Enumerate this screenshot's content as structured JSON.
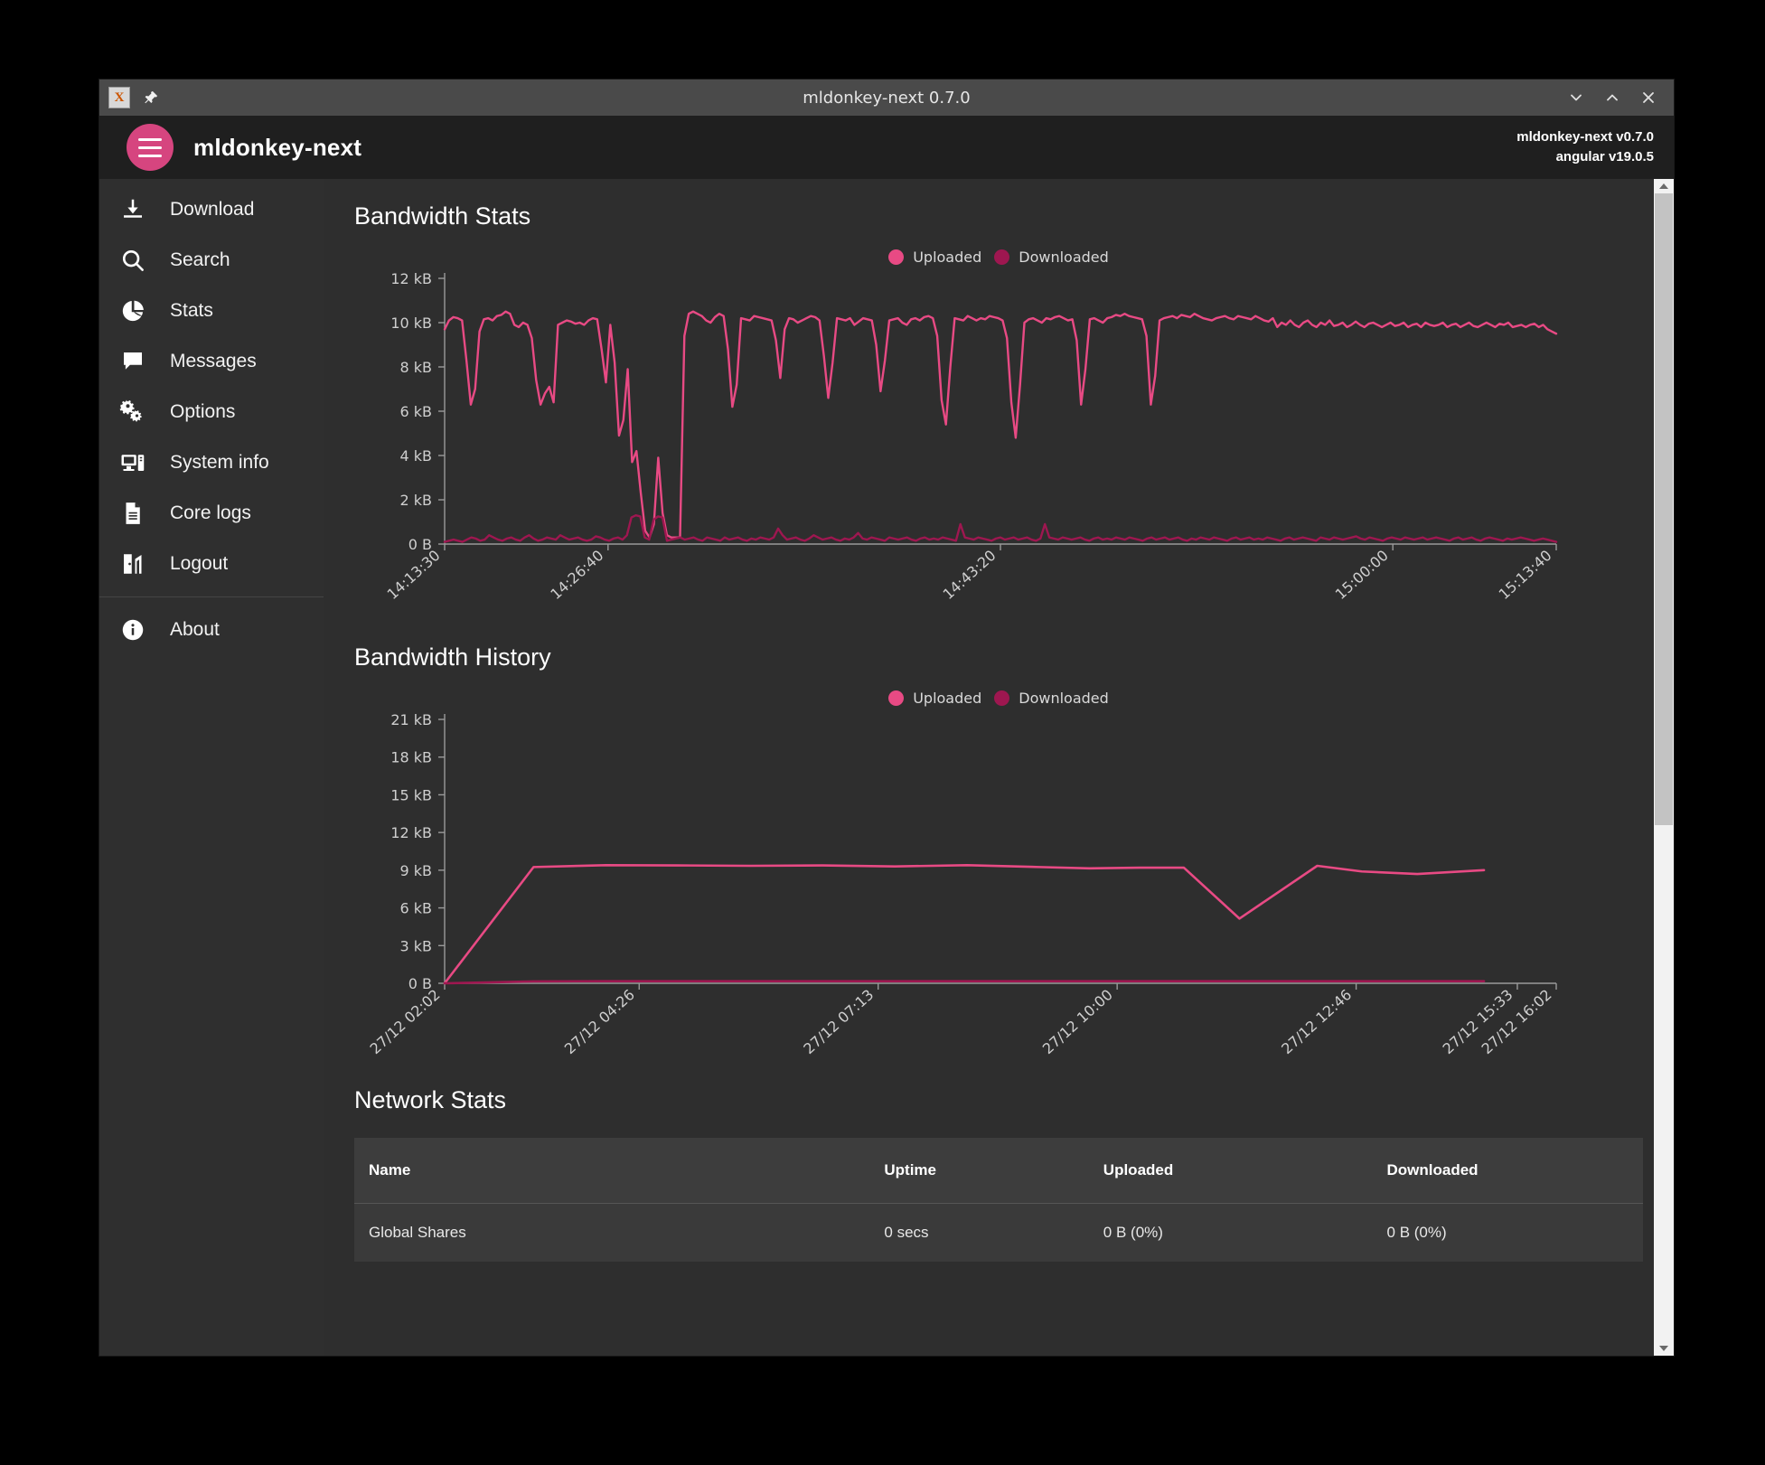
{
  "window": {
    "title": "mldonkey-next 0.7.0",
    "app_icon": "x-app-icon",
    "pin_icon": "pin-icon",
    "minimize_icon": "chevron-down-icon",
    "maximize_icon": "chevron-up-icon",
    "close_icon": "close-icon"
  },
  "appbar": {
    "menu_icon": "hamburger-menu-icon",
    "title": "mldonkey-next",
    "version_app": "mldonkey-next v0.7.0",
    "version_framework": "angular v19.0.5"
  },
  "sidebar": {
    "items": [
      {
        "label": "Download",
        "icon": "download-icon"
      },
      {
        "label": "Search",
        "icon": "search-icon"
      },
      {
        "label": "Stats",
        "icon": "pie-chart-icon"
      },
      {
        "label": "Messages",
        "icon": "chat-bubble-icon"
      },
      {
        "label": "Options",
        "icon": "gears-icon"
      },
      {
        "label": "System info",
        "icon": "desktop-tower-icon"
      },
      {
        "label": "Core logs",
        "icon": "document-icon"
      },
      {
        "label": "Logout",
        "icon": "logout-door-icon"
      }
    ],
    "footer": [
      {
        "label": "About",
        "icon": "info-icon"
      }
    ]
  },
  "colors": {
    "uploaded": "#e84a84",
    "downloaded": "#9e1750",
    "axis": "#9a9a9a",
    "background": "#2e2e2e",
    "accent": "#d6457f"
  },
  "main": {
    "bandwidth_stats_title": "Bandwidth Stats",
    "bandwidth_history_title": "Bandwidth History",
    "network_stats_title": "Network Stats",
    "legend": [
      {
        "label": "Uploaded",
        "color": "#e84a84"
      },
      {
        "label": "Downloaded",
        "color": "#9e1750"
      }
    ],
    "table": {
      "headers": [
        "Name",
        "Uptime",
        "Uploaded",
        "Downloaded"
      ],
      "rows": [
        {
          "name": "Global Shares",
          "uptime": "0 secs",
          "uploaded": "0 B (0%)",
          "downloaded": "0 B (0%)"
        }
      ]
    }
  },
  "chart_data": [
    {
      "type": "line",
      "title": "Bandwidth Stats",
      "xlabel": "",
      "ylabel": "",
      "ylim": [
        0,
        12000
      ],
      "yticks": [
        0,
        2000,
        4000,
        6000,
        8000,
        10000,
        12000
      ],
      "ytick_labels": [
        "0 B",
        "2 kB",
        "4 kB",
        "6 kB",
        "8 kB",
        "10 kB",
        "12 kB"
      ],
      "xtick_labels": [
        "14:13:30",
        "14:26:40",
        "14:43:20",
        "15:00:00",
        "15:13:40"
      ],
      "xtick_positions": [
        0.0,
        0.147,
        0.5,
        0.853,
        1.0
      ],
      "grid": false,
      "legend_position": "top-center",
      "series": [
        {
          "name": "Uploaded",
          "color": "#e84a84",
          "values": [
            9700,
            10100,
            10250,
            10200,
            10100,
            8300,
            6300,
            7000,
            9600,
            10150,
            10200,
            10100,
            10300,
            10350,
            10500,
            10400,
            9900,
            9800,
            10000,
            9900,
            9300,
            7400,
            6300,
            6800,
            7100,
            6400,
            9900,
            10000,
            10100,
            10050,
            9950,
            10000,
            9900,
            10100,
            10200,
            10150,
            8800,
            7300,
            9900,
            8200,
            4900,
            5600,
            7900,
            3700,
            4200,
            2300,
            600,
            300,
            900,
            3900,
            1400,
            400,
            300,
            300,
            300,
            9400,
            10400,
            10500,
            10400,
            10300,
            10100,
            10000,
            10250,
            10400,
            10300,
            8800,
            6200,
            7200,
            10200,
            10150,
            10100,
            10300,
            10250,
            10200,
            10150,
            10100,
            9200,
            7500,
            9700,
            10200,
            10150,
            10000,
            10100,
            10200,
            10300,
            10250,
            10100,
            8500,
            6600,
            8200,
            10200,
            10150,
            10100,
            10200,
            9900,
            10050,
            10200,
            10150,
            10100,
            9000,
            6900,
            8300,
            10100,
            10150,
            10200,
            10000,
            9900,
            10150,
            10200,
            10100,
            10250,
            10300,
            10200,
            9400,
            6500,
            5400,
            8000,
            10200,
            10150,
            10100,
            10300,
            10200,
            10100,
            10200,
            10150,
            10300,
            10250,
            10200,
            10100,
            9300,
            6400,
            4800,
            7200,
            10000,
            10150,
            10200,
            10100,
            10000,
            10200,
            10150,
            10250,
            10300,
            10200,
            10100,
            10150,
            9200,
            6300,
            7900,
            10150,
            10200,
            10100,
            10000,
            10200,
            10250,
            10350,
            10300,
            10400,
            10300,
            10250,
            10200,
            10150,
            9400,
            6300,
            7600,
            10100,
            10200,
            10250,
            10300,
            10200,
            10350,
            10300,
            10250,
            10400,
            10300,
            10200,
            10150,
            10100,
            10200,
            10250,
            10300,
            10200,
            10150,
            10300,
            10250,
            10200,
            10150,
            10300,
            10200,
            10100,
            10050,
            10200,
            9800,
            10000,
            9900,
            10100,
            9900,
            9800,
            10000,
            10100,
            9900,
            9800,
            10000,
            9900,
            10100,
            9850,
            9900,
            10000,
            9800,
            9900,
            10050,
            9900,
            9800,
            9950,
            10000,
            9900,
            9800,
            9900,
            10000,
            9850,
            9900,
            10000,
            9800,
            9900,
            9950,
            9800,
            10000,
            9900,
            9850,
            9900,
            10000,
            9800,
            9900,
            9950,
            9800,
            9900,
            10000,
            9850,
            9800,
            9900,
            10000,
            9900,
            9800,
            9950,
            9900,
            10000,
            9800,
            9850,
            9900,
            9800,
            9900,
            9950,
            9800,
            9900,
            9700,
            9600,
            9500
          ]
        },
        {
          "name": "Downloaded",
          "color": "#9e1750",
          "values": [
            100,
            150,
            200,
            150,
            100,
            200,
            300,
            250,
            150,
            200,
            400,
            300,
            200,
            150,
            250,
            300,
            200,
            150,
            300,
            400,
            250,
            150,
            200,
            300,
            250,
            200,
            400,
            300,
            200,
            250,
            300,
            200,
            150,
            200,
            350,
            300,
            200,
            150,
            250,
            300,
            200,
            400,
            1200,
            1300,
            1250,
            300,
            200,
            1100,
            1250,
            1200,
            150,
            200,
            250,
            300,
            200,
            250,
            300,
            200,
            150,
            300,
            250,
            200,
            150,
            300,
            200,
            250,
            300,
            200,
            150,
            250,
            200,
            300,
            250,
            200,
            300,
            700,
            400,
            200,
            250,
            300,
            200,
            150,
            250,
            400,
            300,
            200,
            250,
            300,
            200,
            150,
            250,
            200,
            300,
            500,
            250,
            200,
            300,
            250,
            200,
            150,
            300,
            250,
            200,
            250,
            300,
            200,
            150,
            250,
            300,
            200,
            250,
            200,
            300,
            250,
            200,
            150,
            900,
            300,
            250,
            200,
            300,
            250,
            200,
            150,
            250,
            300,
            200,
            250,
            300,
            200,
            250,
            300,
            200,
            150,
            250,
            900,
            300,
            250,
            200,
            300,
            250,
            200,
            250,
            300,
            200,
            150,
            250,
            300,
            200,
            250,
            200,
            300,
            250,
            200,
            300,
            250,
            200,
            150,
            250,
            300,
            200,
            250,
            300,
            200,
            250,
            300,
            200,
            150,
            250,
            200,
            300,
            250,
            200,
            300,
            250,
            200,
            150,
            250,
            300,
            200,
            250,
            300,
            200,
            250,
            200,
            300,
            250,
            200,
            150,
            250,
            300,
            200,
            250,
            300,
            250,
            200,
            150,
            300,
            250,
            200,
            300,
            250,
            200,
            250,
            300,
            350,
            250,
            200,
            300,
            250,
            200,
            150,
            250,
            300,
            250,
            200,
            300,
            250,
            200,
            250,
            300,
            200,
            250,
            300,
            250,
            200,
            150,
            250,
            300,
            200,
            250,
            300,
            200,
            150,
            250,
            300,
            250,
            200,
            150,
            250,
            200,
            250,
            300,
            250,
            200,
            150,
            200,
            250,
            200,
            150,
            100
          ]
        }
      ]
    },
    {
      "type": "line",
      "title": "Bandwidth History",
      "xlabel": "",
      "ylabel": "",
      "ylim": [
        0,
        21000
      ],
      "yticks": [
        0,
        3000,
        6000,
        9000,
        12000,
        15000,
        18000,
        21000
      ],
      "ytick_labels": [
        "0 B",
        "3 kB",
        "6 kB",
        "9 kB",
        "12 kB",
        "15 kB",
        "18 kB",
        "21 kB"
      ],
      "xtick_labels": [
        "27/12 02:02",
        "27/12 04:26",
        "27/12 07:13",
        "27/12 10:00",
        "27/12 12:46",
        "27/12 15:33",
        "27/12 16:02"
      ],
      "xtick_positions": [
        0.0,
        0.175,
        0.39,
        0.605,
        0.82,
        0.965,
        1.0
      ],
      "grid": false,
      "legend_position": "top-center",
      "series": [
        {
          "name": "Uploaded",
          "color": "#e84a84",
          "values": [
            0,
            9250,
            9400,
            9380,
            9350,
            9380,
            9300,
            9400,
            9250,
            9150,
            9200,
            9200,
            5150,
            9350,
            8900,
            8700,
            9000
          ],
          "x": [
            0.0,
            0.08,
            0.145,
            0.21,
            0.275,
            0.34,
            0.405,
            0.47,
            0.535,
            0.58,
            0.625,
            0.665,
            0.715,
            0.785,
            0.825,
            0.875,
            0.935
          ]
        },
        {
          "name": "Downloaded",
          "color": "#9e1750",
          "values": [
            0,
            150,
            170,
            170,
            170,
            170,
            170,
            170,
            170,
            170,
            170,
            170,
            170,
            170,
            170,
            170,
            170
          ],
          "x": [
            0.0,
            0.08,
            0.145,
            0.21,
            0.275,
            0.34,
            0.405,
            0.47,
            0.535,
            0.58,
            0.625,
            0.665,
            0.715,
            0.785,
            0.825,
            0.875,
            0.935
          ]
        }
      ]
    }
  ]
}
